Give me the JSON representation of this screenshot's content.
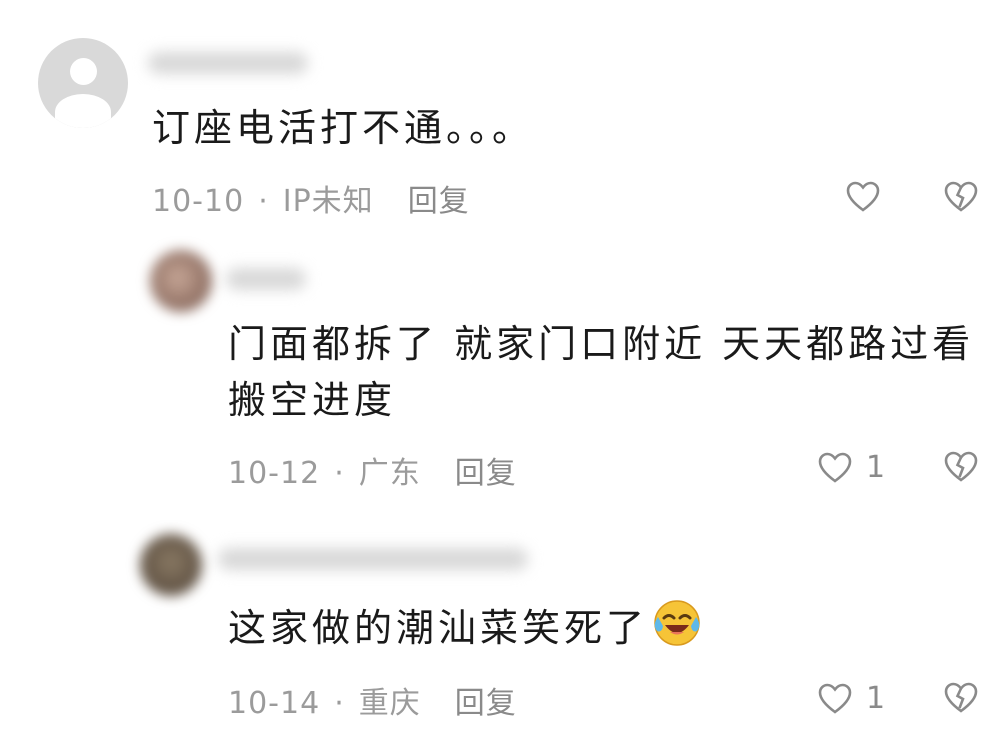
{
  "comments": [
    {
      "text": "订座电活打不通。。。",
      "date": "10-10",
      "separator": "·",
      "location": "IP未知",
      "reply": "回复",
      "likes": "",
      "avatar": "default-avatar-icon"
    },
    {
      "text": "门面都拆了 就家门口附近 天天都路过看搬空进度",
      "date": "10-12",
      "separator": "·",
      "location": "广东",
      "reply": "回复",
      "likes": "1",
      "avatar": "blurred-avatar"
    },
    {
      "text": "这家做的潮汕菜笑死了",
      "date": "10-14",
      "separator": "·",
      "location": "重庆",
      "reply": "回复",
      "likes": "1",
      "avatar": "blurred-avatar",
      "emoji": "laughing-crying-emoji-icon"
    }
  ],
  "colors": {
    "text": "#1a1a1a",
    "meta": "#9b9b9b",
    "icon": "#8a8a8a"
  }
}
